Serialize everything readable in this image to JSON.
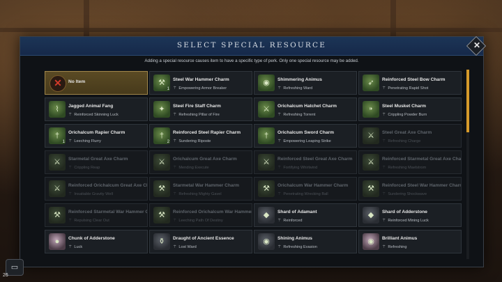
{
  "window": {
    "title": "SELECT SPECIAL RESOURCE",
    "subtitle": "Adding a special resource causes item to have a specific type of perk. Only one special resource may be added.",
    "close_label": "✕"
  },
  "colors": {
    "header": "#1c3556",
    "selected": "#5a4a24",
    "scroll_thumb": "#d69a2a"
  },
  "scroll": {
    "thumb_fraction": 0.33
  },
  "items": [
    {
      "name": "No Item",
      "perk": "",
      "icon": "no-item-icon",
      "state": "selected"
    },
    {
      "name": "Steel War Hammer Charm",
      "perk": "Empowering Armor Breaker",
      "icon": "hammer-charm-icon",
      "tier": "1",
      "state": "active"
    },
    {
      "name": "Shimmering Animus",
      "perk": "Refreshing Ward",
      "icon": "animus-icon",
      "state": "active"
    },
    {
      "name": "Reinforced Steel Bow Charm",
      "perk": "Penetrating Rapid Shot",
      "icon": "bow-charm-icon",
      "state": "active"
    },
    {
      "name": "Jagged Animal Fang",
      "perk": "Reinforced Skinning Luck",
      "icon": "fang-icon",
      "state": "active"
    },
    {
      "name": "Steel Fire Staff Charm",
      "perk": "Refreshing Pillar of Fire",
      "icon": "staff-charm-icon",
      "state": "active"
    },
    {
      "name": "Orichalcum Hatchet Charm",
      "perk": "Refreshing Torrent",
      "icon": "hatchet-charm-icon",
      "state": "active"
    },
    {
      "name": "Steel Musket Charm",
      "perk": "Crippling Powder Burn",
      "icon": "musket-charm-icon",
      "state": "active"
    },
    {
      "name": "Orichalcum Rapier Charm",
      "perk": "Leeching Flurry",
      "icon": "rapier-charm-icon",
      "tier": "1",
      "state": "active"
    },
    {
      "name": "Reinforced Steel Rapier Charm",
      "perk": "Sundering Riposte",
      "icon": "rapier-charm-icon",
      "tier": "2",
      "state": "active"
    },
    {
      "name": "Orichalcum Sword Charm",
      "perk": "Empowering Leaping Strike",
      "icon": "sword-charm-icon",
      "state": "active"
    },
    {
      "name": "Steel Great Axe Charm",
      "perk": "Refreshing Charge",
      "icon": "axe-charm-icon",
      "state": "dim"
    },
    {
      "name": "Starmetal Great Axe Charm",
      "perk": "Crippling Reap",
      "icon": "axe-charm-icon",
      "state": "dim"
    },
    {
      "name": "Orichalcum Great Axe Charm",
      "perk": "Mending Execute",
      "icon": "axe-charm-icon",
      "state": "dim"
    },
    {
      "name": "Reinforced Steel Great Axe Charm",
      "perk": "Fortifying Whirlwind",
      "icon": "axe-charm-icon",
      "state": "dim"
    },
    {
      "name": "Reinforced Starmetal Great Axe Charm",
      "perk": "Refreshing Maelstrom",
      "icon": "axe-charm-icon",
      "state": "dim"
    },
    {
      "name": "Reinforced Orichalcum Great Axe Charm",
      "perk": "Insatiable Gravity Well",
      "icon": "axe-charm-icon",
      "state": "dim"
    },
    {
      "name": "Starmetal War Hammer Charm",
      "perk": "Refreshing Mighty Gavel",
      "icon": "hammer-charm-icon",
      "state": "dim"
    },
    {
      "name": "Orichalcum War Hammer Charm",
      "perk": "Penetrating Wrecking Ball",
      "icon": "hammer-charm-icon",
      "state": "dim"
    },
    {
      "name": "Reinforced Steel War Hammer Charm",
      "perk": "Sundering Shockwave",
      "icon": "hammer-charm-icon",
      "state": "dim"
    },
    {
      "name": "Reinforced Starmetal War Hammer Charm",
      "perk": "Repulsing Clear Out",
      "icon": "hammer-charm-icon",
      "state": "dim"
    },
    {
      "name": "Reinforced Orichalcum War Hammer Charm",
      "perk": "Leeching Path Of Destiny",
      "icon": "hammer-charm-icon",
      "state": "dim"
    },
    {
      "name": "Shard of Adamant",
      "perk": "Reinforced",
      "icon": "shard-icon",
      "state": "resource"
    },
    {
      "name": "Shard of Adderstone",
      "perk": "Reinforced Mining Luck",
      "icon": "shard-icon",
      "state": "resource"
    },
    {
      "name": "Chunk of Adderstone",
      "perk": "Luck",
      "icon": "chunk-icon",
      "state": "resource-pink"
    },
    {
      "name": "Draught of Ancient Essence",
      "perk": "Lost Ward",
      "icon": "draught-icon",
      "state": "resource"
    },
    {
      "name": "Shining Animus",
      "perk": "Refreshing Evasion",
      "icon": "animus-icon",
      "state": "resource"
    },
    {
      "name": "Brilliant Animus",
      "perk": "Refreshing",
      "icon": "animus-icon",
      "state": "resource-pink"
    }
  ],
  "hud": {
    "level": "26",
    "chat_icon": "chat-icon"
  }
}
